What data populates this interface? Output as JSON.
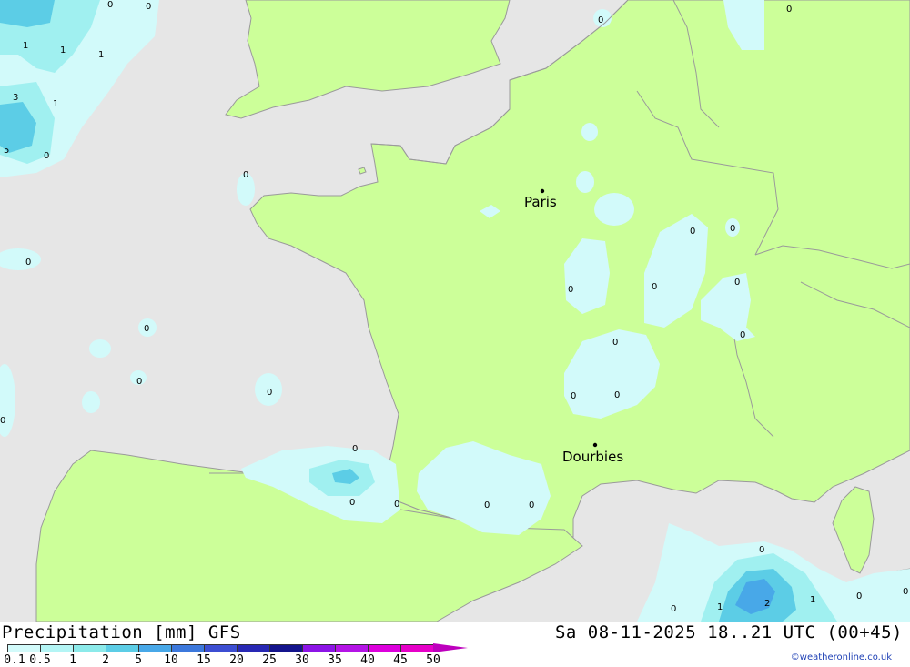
{
  "header": {
    "title": "Precipitation [mm] GFS",
    "time": "Sa 08-11-2025 18..21 UTC (00+45)",
    "credit": "©weatheronline.co.uk"
  },
  "colors": {
    "land": "#ccff99",
    "sea": "#e6e6e6",
    "border": "#9a9a9a",
    "precip_light": "#d2fafa",
    "precip_mid": "#a0f0f0",
    "precip_heavy": "#5ccde6",
    "precip_strong": "#48a8e8"
  },
  "legend": {
    "values": [
      "0.1",
      "0.5",
      "1",
      "2",
      "5",
      "10",
      "15",
      "20",
      "25",
      "30",
      "35",
      "40",
      "45",
      "50"
    ],
    "colors": [
      "#d2fafa",
      "#b4f5f5",
      "#8ceaea",
      "#5ccde6",
      "#48a8e8",
      "#3c78dc",
      "#3c4ed2",
      "#2828b4",
      "#14148c",
      "#8c14e6",
      "#b414e6",
      "#dc00dc",
      "#e600c8",
      "#bd00bd"
    ]
  },
  "cities": [
    {
      "name": "Paris"
    },
    {
      "name": "Dourbies"
    }
  ],
  "precip_labels": [
    "0",
    "0",
    "1",
    "1",
    "1",
    "3",
    "1",
    "5",
    "0",
    "0",
    "0",
    "0",
    "0",
    "0",
    "0",
    "0",
    "0",
    "0",
    "0",
    "0",
    "0",
    "0",
    "0",
    "0",
    "0",
    "0",
    "0",
    "0",
    "0",
    "0",
    "0",
    "1",
    "2",
    "1",
    "0",
    "0"
  ]
}
